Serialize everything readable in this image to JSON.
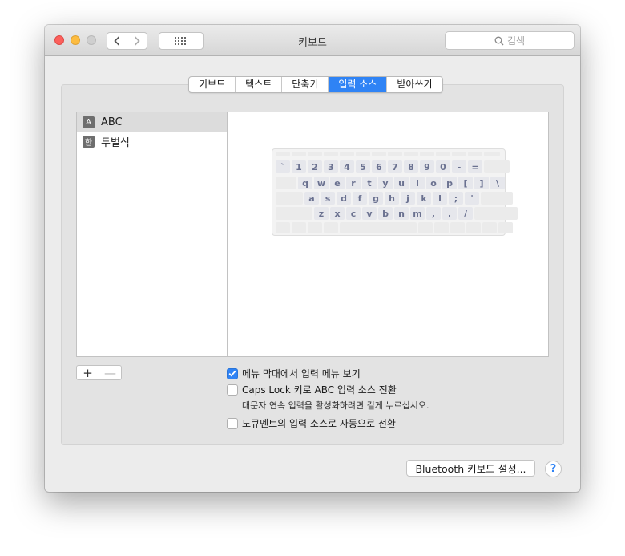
{
  "window": {
    "title": "키보드"
  },
  "toolbar": {
    "search_placeholder": "검색"
  },
  "tabs": [
    {
      "label": "키보드",
      "active": false
    },
    {
      "label": "텍스트",
      "active": false
    },
    {
      "label": "단축키",
      "active": false
    },
    {
      "label": "입력 소스",
      "active": true
    },
    {
      "label": "받아쓰기",
      "active": false
    }
  ],
  "sources": [
    {
      "badge": "A",
      "label": "ABC",
      "selected": true
    },
    {
      "badge": "한",
      "label": "두벌식",
      "selected": false
    }
  ],
  "keyboard": {
    "row1": [
      "`",
      "1",
      "2",
      "3",
      "4",
      "5",
      "6",
      "7",
      "8",
      "9",
      "0",
      "-",
      "="
    ],
    "row2": [
      "q",
      "w",
      "e",
      "r",
      "t",
      "y",
      "u",
      "i",
      "o",
      "p",
      "[",
      "]",
      "\\"
    ],
    "row3": [
      "a",
      "s",
      "d",
      "f",
      "g",
      "h",
      "j",
      "k",
      "l",
      ";",
      "'"
    ],
    "row4": [
      "z",
      "x",
      "c",
      "v",
      "b",
      "n",
      "m",
      ",",
      ".",
      "/"
    ]
  },
  "list_buttons": {
    "add": "+",
    "remove": "—"
  },
  "options": {
    "show_menu": {
      "label": "메뉴 막대에서 입력 메뉴 보기",
      "checked": true
    },
    "caps_lock": {
      "label": "Caps Lock 키로 ABC 입력 소스 전환",
      "checked": false,
      "hint": "대문자 연속 입력을 활성화하려면 길게 누르십시오."
    },
    "auto_switch": {
      "label": "도큐멘트의 입력 소스로 자동으로 전환",
      "checked": false
    }
  },
  "footer": {
    "bluetooth_label": "Bluetooth 키보드 설정...",
    "help_label": "?"
  },
  "colors": {
    "accent": "#2f83f5",
    "key_text": "#6a7190",
    "close": "#fc605c",
    "minimize": "#fdbc40"
  }
}
